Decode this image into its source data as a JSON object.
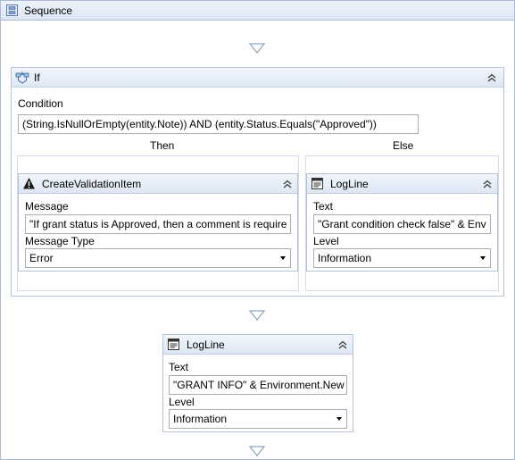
{
  "sequence": {
    "title": "Sequence"
  },
  "if_activity": {
    "title": "If",
    "condition_label": "Condition",
    "condition_value": "(String.IsNullOrEmpty(entity.Note)) AND (entity.Status.Equals(\"Approved\"))",
    "then_label": "Then",
    "else_label": "Else",
    "then_activity": {
      "title": "CreateValidationItem",
      "message_label": "Message",
      "message_value": "\"If grant status is Approved, then a comment is require",
      "message_type_label": "Message Type",
      "message_type_value": "Error"
    },
    "else_activity": {
      "title": "LogLine",
      "text_label": "Text",
      "text_value": "\"Grant condition check false\" & Env",
      "level_label": "Level",
      "level_value": "Information"
    }
  },
  "logline_activity": {
    "title": "LogLine",
    "text_label": "Text",
    "text_value": "\"GRANT INFO\" & Environment.New",
    "level_label": "Level",
    "level_value": "Information"
  }
}
